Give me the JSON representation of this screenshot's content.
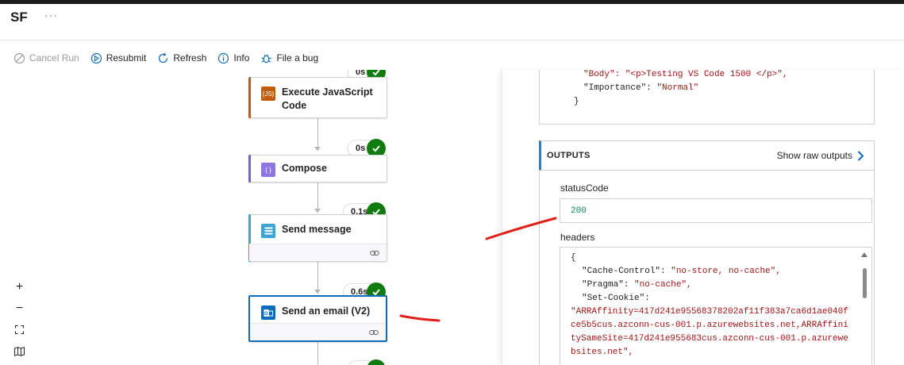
{
  "app": {
    "title": "SF",
    "more": "···"
  },
  "toolbar": {
    "cancel_run": "Cancel Run",
    "resubmit": "Resubmit",
    "refresh": "Refresh",
    "info": "Info",
    "file_bug": "File a bug"
  },
  "flow": {
    "steps": [
      {
        "title": "Execute JavaScript Code",
        "duration": "0s",
        "icon": "javascript-icon",
        "color": "#c15d0a"
      },
      {
        "title": "Compose",
        "duration": "0s",
        "icon": "compose-icon",
        "color": "#7b5ddc"
      },
      {
        "title": "Send message",
        "duration": "0.1s",
        "icon": "message-icon",
        "color": "#3ea4d8"
      },
      {
        "title": "Send an email (V2)",
        "duration": "0.6s",
        "icon": "outlook-icon",
        "color": "#0f6cbd"
      }
    ]
  },
  "zoom_controls": {
    "zoom_in": "+",
    "zoom_out": "−"
  },
  "panel": {
    "input_json": {
      "body_line": "\"Body\": \"<p>Testing VS Code 1500 </p>\",",
      "importance_key": "\"Importance\":",
      "importance_value": "\"Normal\"",
      "close_brace": "}"
    },
    "outputs": {
      "title": "OUTPUTS",
      "show_raw": "Show raw outputs",
      "status_label": "statusCode",
      "status_value": "200",
      "headers_label": "headers",
      "headers_lines": {
        "open": "{",
        "cache_key": "\"Cache-Control\":",
        "cache_value": "\"no-store, no-cache\",",
        "pragma_key": "\"Pragma\":",
        "pragma_value": "\"no-cache\",",
        "cookie_key": "\"Set-Cookie\":",
        "cookie_value": "\"ARRAffinity=417d241e95568378202af11f383a7ca6d1ae040fce5b5cus.azconn-cus-001.p.azurewebsites.net,ARRAffinitySameSite=417d241e955683cus.azconn-cus-001.p.azurewebsites.net\","
      }
    }
  }
}
